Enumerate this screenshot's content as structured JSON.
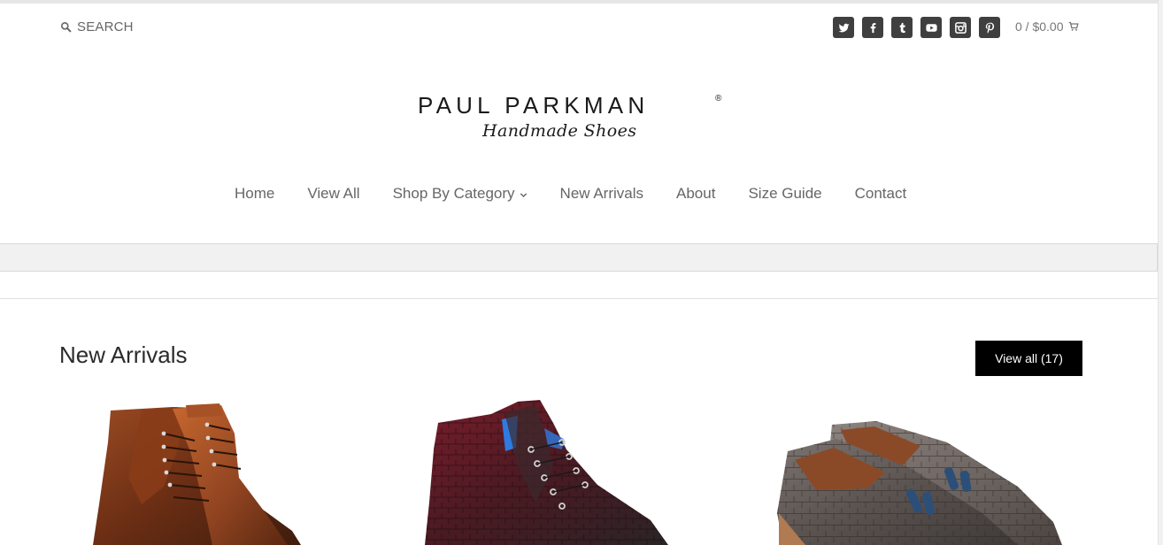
{
  "header": {
    "search_label": "SEARCH",
    "cart_label": "0 / $0.00",
    "social_icons": [
      "twitter-icon",
      "facebook-icon",
      "tumblr-icon",
      "youtube-icon",
      "instagram-icon",
      "pinterest-icon"
    ]
  },
  "logo": {
    "name": "PAUL PARKMAN",
    "registered": "®",
    "tagline": "Handmade Shoes"
  },
  "nav": {
    "items": [
      {
        "label": "Home"
      },
      {
        "label": "View All"
      },
      {
        "label": "Shop By Category"
      },
      {
        "label": "New Arrivals"
      },
      {
        "label": "About"
      },
      {
        "label": "Size Guide"
      },
      {
        "label": "Contact"
      }
    ]
  },
  "new_arrivals": {
    "title": "New Arrivals",
    "view_all_label": "View all (17)"
  },
  "colors": {
    "icon_bg": "#3f3f3f",
    "button_bg": "#000000",
    "strip_bg": "#f1f1f1"
  }
}
